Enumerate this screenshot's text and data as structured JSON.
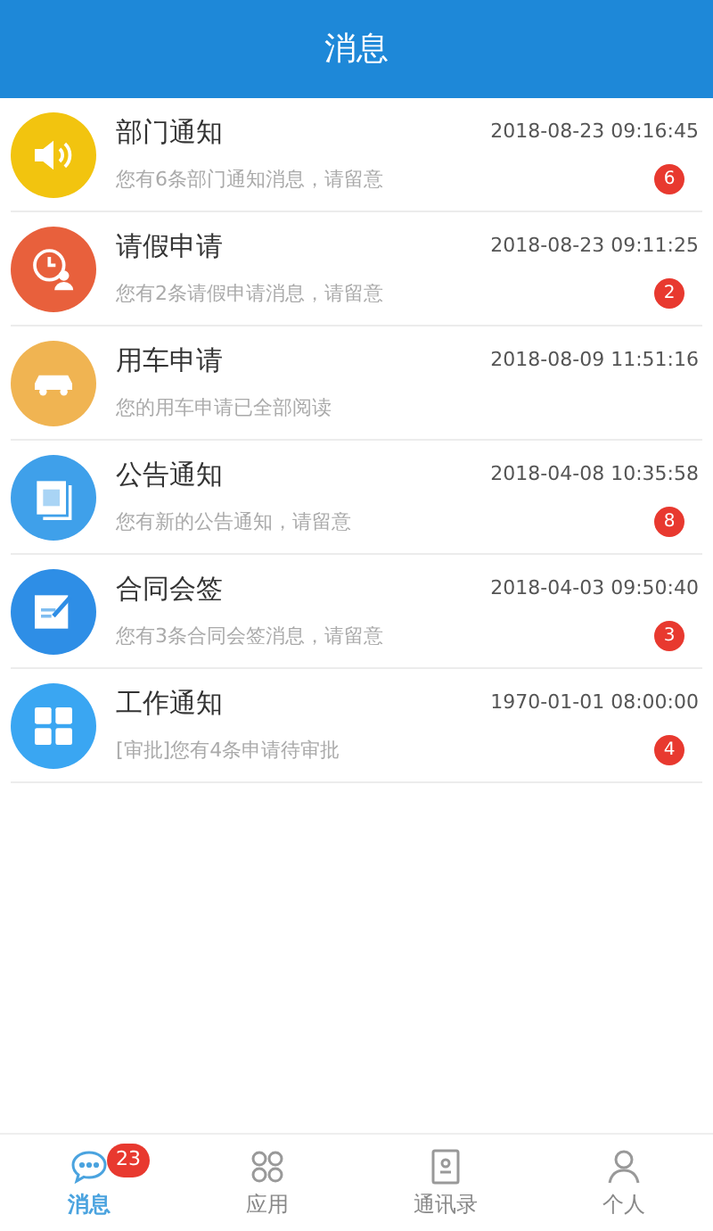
{
  "header": {
    "title": "消息"
  },
  "messages": [
    {
      "kind": "speaker",
      "color": "#f2c40f",
      "title": "部门通知",
      "time": "2018-08-23 09:16:45",
      "summary": "您有6条部门通知消息，请留意",
      "badge": "6"
    },
    {
      "kind": "clock-person",
      "color": "#e8603c",
      "title": "请假申请",
      "time": "2018-08-23 09:11:25",
      "summary": "您有2条请假申请消息，请留意",
      "badge": "2"
    },
    {
      "kind": "car",
      "color": "#f0b452",
      "title": "用车申请",
      "time": "2018-08-09 11:51:16",
      "summary": "您的用车申请已全部阅读"
    },
    {
      "kind": "document",
      "color": "#3fa0ea",
      "title": "公告通知",
      "time": "2018-04-08 10:35:58",
      "summary": "您有新的公告通知，请留意",
      "badge": "8"
    },
    {
      "kind": "edit",
      "color": "#2e8ee6",
      "title": "合同会签",
      "time": "2018-04-03 09:50:40",
      "summary": "您有3条合同会签消息，请留意",
      "badge": "3"
    },
    {
      "kind": "grid",
      "color": "#3aa6f2",
      "title": "工作通知",
      "time": "1970-01-01 08:00:00",
      "summary": "[审批]您有4条申请待审批",
      "badge": "4"
    }
  ],
  "tabs": [
    {
      "kind": "chat",
      "label": "消息",
      "selected": true,
      "badge": "23"
    },
    {
      "kind": "apps",
      "label": "应用",
      "selected": false
    },
    {
      "kind": "contacts",
      "label": "通讯录",
      "selected": false
    },
    {
      "kind": "person",
      "label": "个人",
      "selected": false
    }
  ]
}
